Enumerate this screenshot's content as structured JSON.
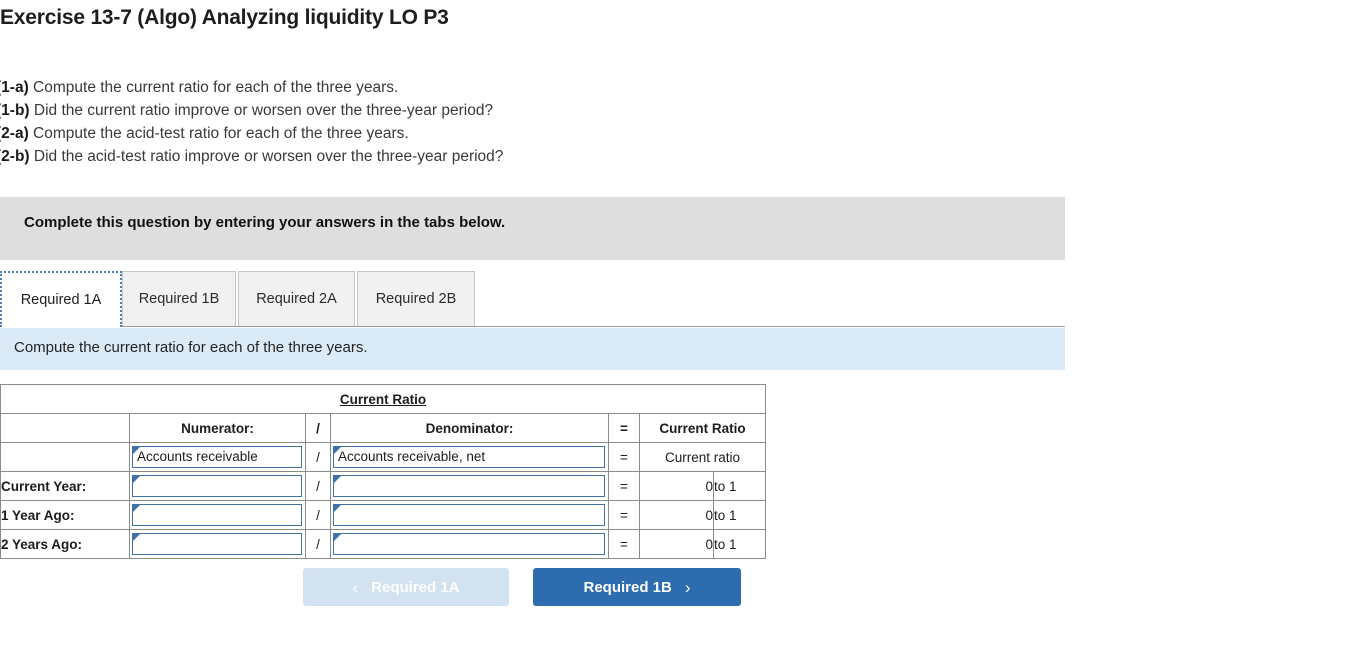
{
  "page_title": "Exercise 13-7 (Algo) Analyzing liquidity LO P3",
  "requirements": [
    {
      "key": "(1-a)",
      "text": "Compute the current ratio for each of the three years."
    },
    {
      "key": "(1-b)",
      "text": "Did the current ratio improve or worsen over the three-year period?"
    },
    {
      "key": "(2-a)",
      "text": "Compute the acid-test ratio for each of the three years."
    },
    {
      "key": "(2-b)",
      "text": "Did the acid-test ratio improve or worsen over the three-year period?"
    }
  ],
  "banner": {
    "text": "Complete this question by entering your answers in the tabs below."
  },
  "tabs": [
    {
      "label": "Required 1A",
      "active": true
    },
    {
      "label": "Required 1B",
      "active": false
    },
    {
      "label": "Required 2A",
      "active": false
    },
    {
      "label": "Required 2B",
      "active": false
    }
  ],
  "instruction": {
    "text": "Compute the current ratio for each of the three years."
  },
  "table": {
    "title": "Current Ratio",
    "headers": {
      "blank": "",
      "numerator": "Numerator:",
      "divider": "/",
      "denominator": "Denominator:",
      "equals": "=",
      "result": "Current Ratio"
    },
    "label_row": {
      "label": "",
      "numerator": "Accounts receivable",
      "divider": "/",
      "denominator": "Accounts receivable, net",
      "equals": "=",
      "result": "Current ratio",
      "unit": ""
    },
    "rows": [
      {
        "label": "Current Year:",
        "numerator": "",
        "divider": "/",
        "denominator": "",
        "equals": "=",
        "result": "0",
        "unit": "to 1"
      },
      {
        "label": "1 Year Ago:",
        "numerator": "",
        "divider": "/",
        "denominator": "",
        "equals": "=",
        "result": "0",
        "unit": "to 1"
      },
      {
        "label": "2 Years Ago:",
        "numerator": "",
        "divider": "/",
        "denominator": "",
        "equals": "=",
        "result": "0",
        "unit": "to 1"
      }
    ]
  },
  "nav": {
    "prev_label": "Required 1A",
    "prev_chevron": "‹",
    "next_label": "Required 1B",
    "next_chevron": "›"
  },
  "colors": {
    "header_blue": "#7aaee2",
    "instruction_blue": "#daeaf7",
    "banner_gray": "#dedede",
    "button_active": "#2e6cb0",
    "button_disabled": "#d3e2f0",
    "input_border": "#3f72ab"
  }
}
